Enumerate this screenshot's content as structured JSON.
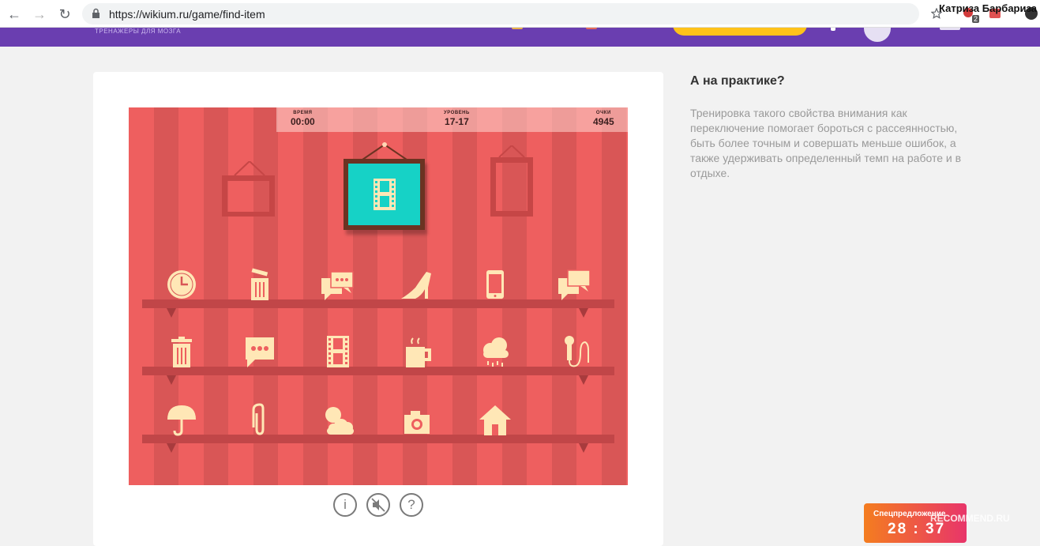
{
  "browser": {
    "url": "https://wikium.ru/game/find-item",
    "user_name": "Катриза Барбариза",
    "badge_count": "2"
  },
  "site": {
    "tagline": "ТРЕНАЖЕРЫ ДЛЯ МОЗГА"
  },
  "game": {
    "hud": {
      "time_label": "ВРЕМЯ",
      "time_value": "00:00",
      "level_label": "УРОВЕНЬ",
      "level_value": "17-17",
      "score_label": "ОЧКИ",
      "score_value": "4945"
    },
    "target_item": "film-strip-icon",
    "shelves": [
      [
        "clock-icon",
        "trash-can-open-icon",
        "chat-bubbles-icon",
        "high-heel-icon",
        "phone-icon",
        "chat-double-icon"
      ],
      [
        "trash-can-icon",
        "speech-bubble-icon",
        "film-strip-icon",
        "coffee-cup-icon",
        "rain-cloud-icon",
        "microphone-icon"
      ],
      [
        "umbrella-icon",
        "paperclip-icon",
        "sun-cloud-icon",
        "camera-icon",
        "house-icon"
      ]
    ],
    "colors": {
      "wall_light": "#ee5f5f",
      "wall_dark": "#d95656",
      "item": "#ffe7b6",
      "target_bg": "#16d2c6",
      "frame": "#6b3322"
    },
    "controls": {
      "info_glyph": "i",
      "help_glyph": "?"
    }
  },
  "sidebar": {
    "title": "А на практике?",
    "text": "Тренировка такого свойства внимания как переключение помогает бороться с рассеянностью, быть более точным и совершать меньше ошибок, а также удерживать определенный темп на работе и в отдыхе."
  },
  "promo": {
    "label": "Спецпредложение",
    "timer": "28 : 37"
  },
  "watermark": "RECOMMEND.RU"
}
